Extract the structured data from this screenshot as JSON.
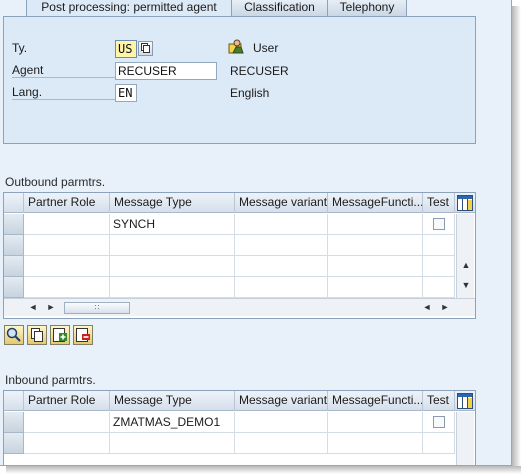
{
  "tabs": [
    {
      "label": "Post processing: permitted agent",
      "active": true
    },
    {
      "label": "Classification",
      "active": false
    },
    {
      "label": "Telephony",
      "active": false
    }
  ],
  "header": {
    "type": {
      "label": "Ty.",
      "value": "US",
      "description": "User",
      "icon": "person-icon"
    },
    "agent": {
      "label": "Agent",
      "value": "RECUSER",
      "description": "RECUSER"
    },
    "language": {
      "label": "Lang.",
      "value": "EN",
      "description": "English"
    }
  },
  "outbound": {
    "title": "Outbound parmtrs.",
    "columns": [
      "Partner Role",
      "Message Type",
      "Message variant",
      "MessageFuncti...",
      "Test"
    ],
    "rows": [
      {
        "partner_role": "",
        "message_type": "SYNCH",
        "message_variant": "",
        "message_function": "",
        "test": false
      },
      {
        "partner_role": "",
        "message_type": "",
        "message_variant": "",
        "message_function": "",
        "test": null
      },
      {
        "partner_role": "",
        "message_type": "",
        "message_variant": "",
        "message_function": "",
        "test": null
      },
      {
        "partner_role": "",
        "message_type": "",
        "message_variant": "",
        "message_function": "",
        "test": null
      }
    ]
  },
  "toolbar": {
    "buttons": [
      "details-icon",
      "copy-icon",
      "create-icon",
      "delete-icon"
    ]
  },
  "inbound": {
    "title": "Inbound parmtrs.",
    "columns": [
      "Partner Role",
      "Message Type",
      "Message variant",
      "MessageFuncti...",
      "Test"
    ],
    "rows": [
      {
        "partner_role": "",
        "message_type": "ZMATMAS_DEMO1",
        "message_variant": "",
        "message_function": "",
        "test": false
      }
    ]
  },
  "colors": {
    "panel": "#dce9f6",
    "background": "#e8f1fa",
    "input_required": "#fff4a8"
  }
}
